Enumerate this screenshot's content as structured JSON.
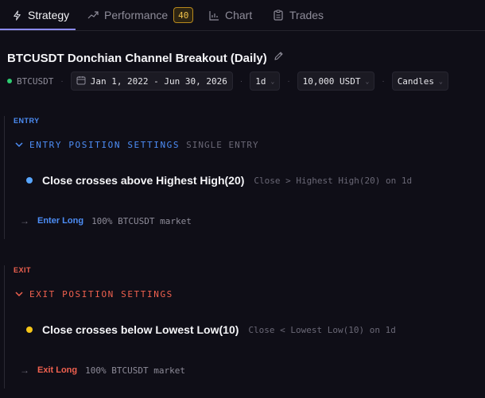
{
  "tabs": [
    {
      "label": "Strategy",
      "icon": "bolt-icon"
    },
    {
      "label": "Performance",
      "icon": "trend-icon",
      "badge": "40"
    },
    {
      "label": "Chart",
      "icon": "chart-icon"
    },
    {
      "label": "Trades",
      "icon": "clipboard-icon"
    }
  ],
  "strategy": {
    "title": "BTCUSDT Donchian Channel Breakout (Daily)",
    "symbol": "BTCUSDT",
    "date_range": "Jan 1, 2022 - Jun 30, 2026",
    "interval": "1d",
    "capital": "10,000 USDT",
    "chart_type": "Candles"
  },
  "entry": {
    "label": "ENTRY",
    "heading": "ENTRY POSITION SETTINGS",
    "mode": "SINGLE ENTRY",
    "condition": "Close crosses above Highest High(20)",
    "condition_desc": "Close > Highest High(20) on 1d",
    "action_label": "Enter Long",
    "action_desc": "100% BTCUSDT market"
  },
  "exit": {
    "label": "EXIT",
    "heading": "EXIT POSITION SETTINGS",
    "condition": "Close crosses below Lowest Low(10)",
    "condition_desc": "Close < Lowest Low(10) on 1d",
    "action_label": "Exit Long",
    "action_desc": "100% BTCUSDT market"
  },
  "colors": {
    "accent": "#8b8af0",
    "entry": "#4d8ef7",
    "exit": "#f0614f",
    "entry_bullet": "#58a6ff",
    "exit_bullet": "#f5c518"
  }
}
